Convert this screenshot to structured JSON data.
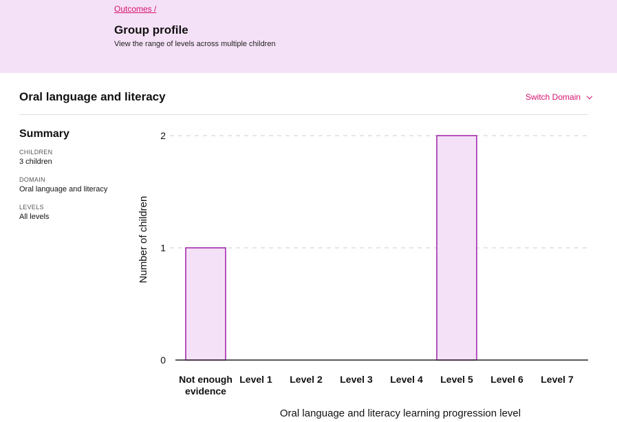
{
  "header": {
    "breadcrumb": "Outcomes /",
    "title": "Group profile",
    "subtitle": "View the range of levels across multiple children"
  },
  "domain": {
    "title": "Oral language and literacy",
    "switch_label": "Switch Domain",
    "switch_icon": "chevron-down-icon"
  },
  "summary": {
    "title": "Summary",
    "items": [
      {
        "label": "CHILDREN",
        "value": "3 children"
      },
      {
        "label": "DOMAIN",
        "value": "Oral language and literacy"
      },
      {
        "label": "LEVELS",
        "value": "All levels"
      }
    ]
  },
  "colors": {
    "accent": "#d4126f",
    "header_bg": "#f5e1f7",
    "bar_fill": "#f5e1f7",
    "bar_stroke": "#9b1fa8"
  },
  "chart_data": {
    "type": "bar",
    "categories": [
      [
        "Not enough",
        "evidence"
      ],
      [
        "Level 1"
      ],
      [
        "Level 2"
      ],
      [
        "Level 3"
      ],
      [
        "Level 4"
      ],
      [
        "Level 5"
      ],
      [
        "Level 6"
      ],
      [
        "Level 7"
      ]
    ],
    "values": [
      1,
      0,
      0,
      0,
      0,
      2,
      0,
      0
    ],
    "xlabel": "Oral language and literacy learning progression level",
    "ylabel": "Number of children",
    "ylim": [
      0,
      2
    ],
    "yticks": [
      0,
      1,
      2
    ],
    "grid": "horizontal-dashed"
  }
}
